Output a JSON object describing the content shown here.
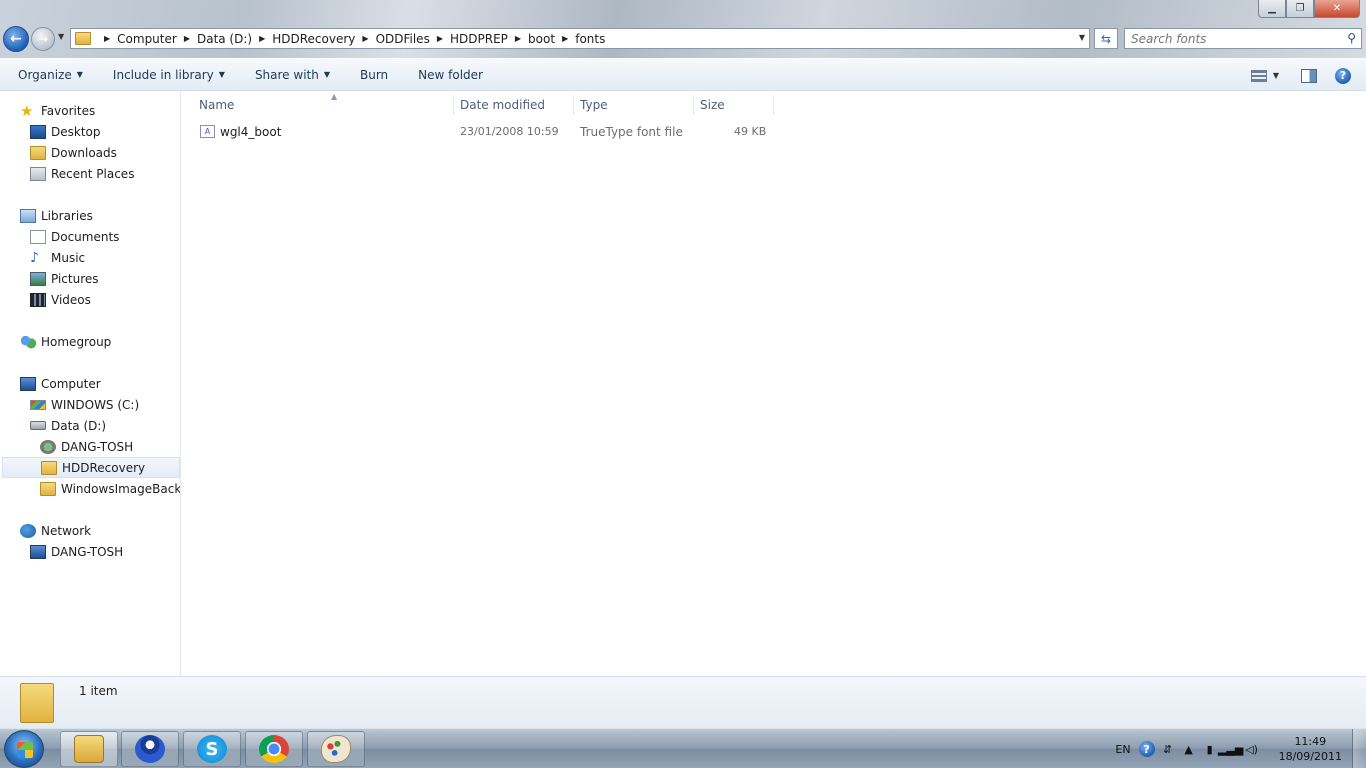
{
  "window": {
    "minimize": "▁",
    "maximize": "❐",
    "close": "✕"
  },
  "address": {
    "crumbs": [
      "Computer",
      "Data (D:)",
      "HDDRecovery",
      "ODDFiles",
      "HDDPREP",
      "boot",
      "fonts"
    ]
  },
  "search": {
    "placeholder": "Search fonts"
  },
  "toolbar": {
    "organize": "Organize",
    "include_in_library": "Include in library",
    "share_with": "Share with",
    "burn": "Burn",
    "new_folder": "New folder"
  },
  "nav": {
    "favorites": "Favorites",
    "desktop": "Desktop",
    "downloads": "Downloads",
    "recent_places": "Recent Places",
    "libraries": "Libraries",
    "documents": "Documents",
    "music": "Music",
    "pictures": "Pictures",
    "videos": "Videos",
    "homegroup": "Homegroup",
    "computer": "Computer",
    "windows_c": "WINDOWS (C:)",
    "data_d": "Data (D:)",
    "dang_tosh_drive": "DANG-TOSH",
    "hddrecovery": "HDDRecovery",
    "windowsimagebackup": "WindowsImageBackup",
    "network": "Network",
    "dang_tosh_net": "DANG-TOSH"
  },
  "columns": {
    "name": "Name",
    "date_modified": "Date modified",
    "type": "Type",
    "size": "Size"
  },
  "files": [
    {
      "name": "wgl4_boot",
      "date_modified": "23/01/2008 10:59",
      "type": "TrueType font file",
      "size": "49 KB"
    }
  ],
  "details": {
    "item_count": "1 item"
  },
  "tray": {
    "language": "EN",
    "time": "11:49",
    "date": "18/09/2011"
  }
}
